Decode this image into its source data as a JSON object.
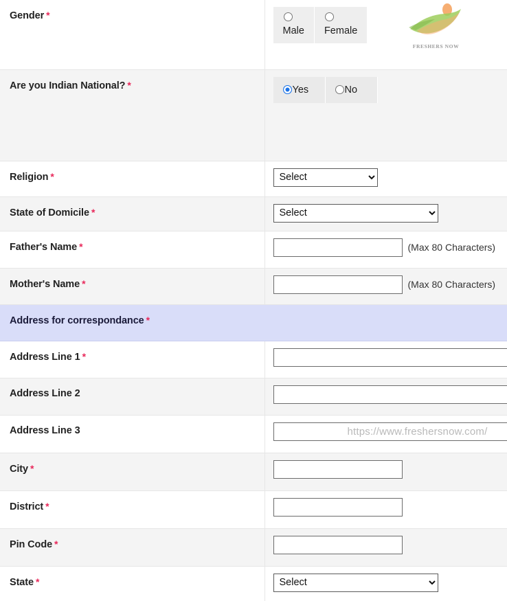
{
  "brand": {
    "logo_text": "FRESHERS NOW",
    "logo_colors": {
      "leaf": "#8cc63f",
      "accent": "#f5a05a",
      "text": "#8a8a8a"
    },
    "watermark_url": "https://www.freshersnow.com/"
  },
  "theme": {
    "required_marker_color": "#e8285a",
    "section_header_bg": "#d9ddf9",
    "shaded_row_bg": "#f4f4f4",
    "radio_cell_bg": "#eeeeee",
    "selected_radio_color": "#1a73e8"
  },
  "common": {
    "required_marker": "*",
    "select_placeholder": "Select",
    "max80_hint": "(Max 80 Characters)",
    "empty_value": ""
  },
  "rows": [
    {
      "key": "gender",
      "label": "Gender",
      "required": true,
      "type": "radio-stack",
      "options": [
        {
          "label": "Male",
          "checked": false
        },
        {
          "label": "Female",
          "checked": false
        }
      ]
    },
    {
      "key": "indian_national",
      "label": "Are you Indian National?",
      "required": true,
      "type": "radio-inline",
      "options": [
        {
          "label": "Yes",
          "checked": true
        },
        {
          "label": "No",
          "checked": false
        }
      ]
    },
    {
      "key": "religion",
      "label": "Religion",
      "required": true,
      "type": "select-narrow",
      "value": "Select"
    },
    {
      "key": "state_of_domicile",
      "label": "State of Domicile",
      "required": true,
      "type": "select-wide",
      "value": "Select"
    },
    {
      "key": "fathers_name",
      "label": "Father's Name",
      "required": true,
      "type": "text-short-hint",
      "value": "",
      "hint": "(Max 80 Characters)"
    },
    {
      "key": "mothers_name",
      "label": "Mother's Name",
      "required": true,
      "type": "text-short-hint",
      "value": "",
      "hint": "(Max 80 Characters)"
    },
    {
      "key": "address_section",
      "label": "Address for correspondance",
      "required": true,
      "type": "section"
    },
    {
      "key": "address_line_1",
      "label": "Address Line 1",
      "required": true,
      "type": "text-wide",
      "value": ""
    },
    {
      "key": "address_line_2",
      "label": "Address Line 2",
      "required": false,
      "type": "text-wide",
      "value": ""
    },
    {
      "key": "address_line_3",
      "label": "Address Line 3",
      "required": false,
      "type": "text-wide-watermark",
      "value": "",
      "watermark": "https://www.freshersnow.com/"
    },
    {
      "key": "city",
      "label": "City",
      "required": true,
      "type": "text-short",
      "value": ""
    },
    {
      "key": "district",
      "label": "District",
      "required": true,
      "type": "text-short",
      "value": ""
    },
    {
      "key": "pin_code",
      "label": "Pin Code",
      "required": true,
      "type": "text-short",
      "value": ""
    },
    {
      "key": "state",
      "label": "State",
      "required": true,
      "type": "select-wide",
      "value": "Select"
    }
  ]
}
